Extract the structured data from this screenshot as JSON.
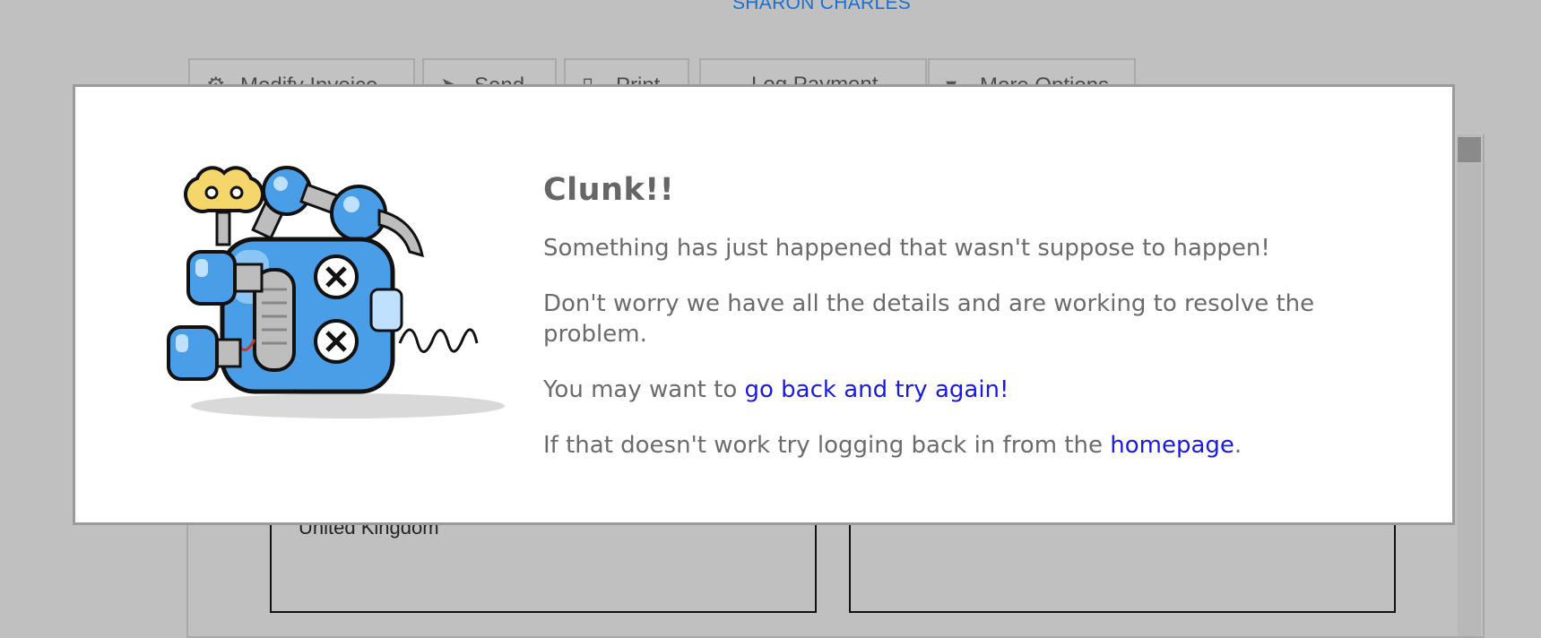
{
  "background": {
    "customer_name": "SHARON CHARLES",
    "toolbar": [
      {
        "label": "Modify Invoice",
        "icon": "gear-icon"
      },
      {
        "label": "Send",
        "icon": "paper-plane-icon"
      },
      {
        "label": "Print",
        "icon": "file-icon"
      },
      {
        "label": "Log Payment",
        "icon": "credit-card-icon"
      },
      {
        "label": "More Options",
        "icon": "caret-down-icon"
      }
    ],
    "address_line": "United Kingdom"
  },
  "error_modal": {
    "title": "Clunk!!",
    "message_1": "Something has just happened that wasn't suppose to happen!",
    "message_2": "Don't worry we have all the details and are working to resolve the problem.",
    "message_3_prefix": "You may want to ",
    "message_3_link": "go back and try again!",
    "message_4_prefix": "If that doesn't work try logging back in from the ",
    "message_4_link": "homepage",
    "message_4_suffix": "."
  },
  "colors": {
    "overlay_background": "#c0c0c0",
    "link": "#1a1ae0",
    "customer_name": "#1a6fd0",
    "robot_body": "#4a9ee8",
    "robot_key": "#f5d66a"
  }
}
